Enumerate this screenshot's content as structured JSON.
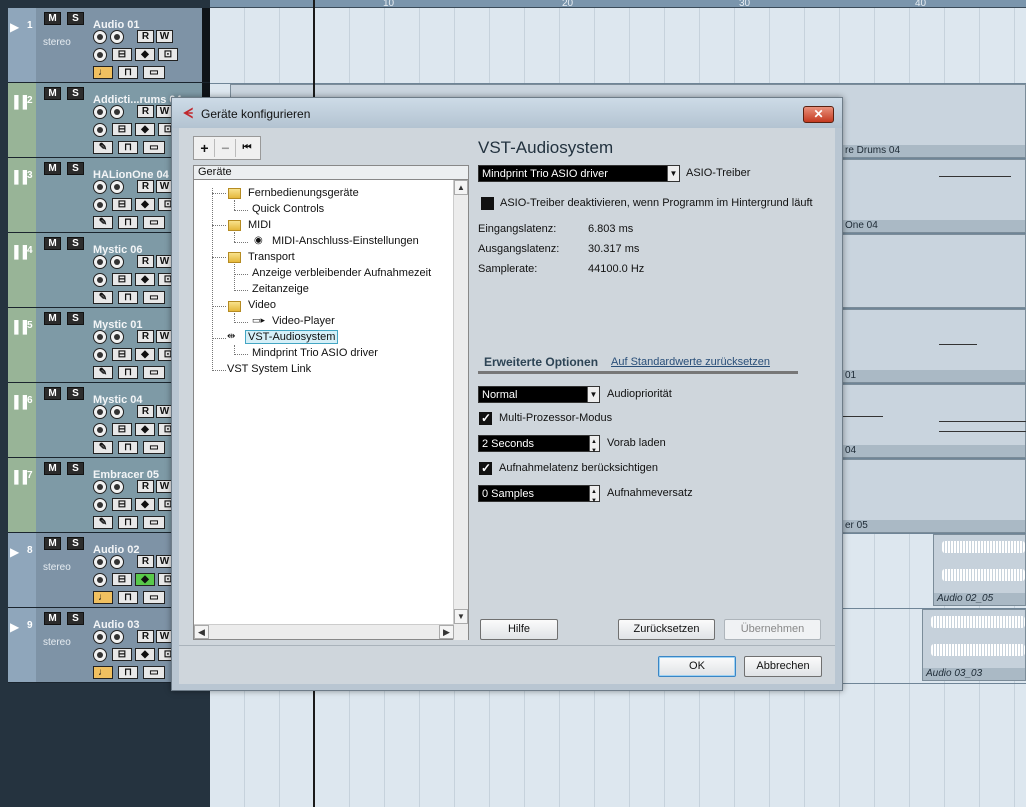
{
  "ruler": {
    "marks": [
      "10",
      "20",
      "30",
      "40"
    ]
  },
  "tracks": [
    {
      "num": "1",
      "name": "Audio 01",
      "sub": "stereo",
      "kind": "audio"
    },
    {
      "num": "2",
      "name": "Addicti...rums 04",
      "sub": "",
      "kind": "inst"
    },
    {
      "num": "3",
      "name": "HALionOne 04",
      "sub": "",
      "kind": "inst"
    },
    {
      "num": "4",
      "name": "Mystic 06",
      "sub": "",
      "kind": "inst"
    },
    {
      "num": "5",
      "name": "Mystic 01",
      "sub": "",
      "kind": "inst"
    },
    {
      "num": "6",
      "name": "Mystic 04",
      "sub": "",
      "kind": "inst"
    },
    {
      "num": "7",
      "name": "Embracer 05",
      "sub": "",
      "kind": "inst"
    },
    {
      "num": "8",
      "name": "Audio 02",
      "sub": "stereo",
      "kind": "audio"
    },
    {
      "num": "9",
      "name": "Audio 03",
      "sub": "stereo",
      "kind": "audio"
    }
  ],
  "track_buttons": {
    "mute": "M",
    "solo": "S",
    "read": "R",
    "write": "W",
    "edit": "e"
  },
  "parts": {
    "p2": "re Drums 04",
    "p3": "One 04",
    "p5": "01",
    "p6": "04",
    "p7": "er 05",
    "p8": "Audio 02_05",
    "p9": "Audio 03_03"
  },
  "dialog": {
    "title": "Geräte konfigurieren",
    "close": "✕",
    "toolbar": {
      "add": "+",
      "remove": "−",
      "reset": "⏮"
    },
    "tree_header": "Geräte",
    "tree": {
      "item1": "Fernbedienungsgeräte",
      "item1a": "Quick Controls",
      "item2": "MIDI",
      "item2a": "MIDI-Anschluss-Einstellungen",
      "item3": "Transport",
      "item3a": "Anzeige verbleibender Aufnahmezeit",
      "item3b": "Zeitanzeige",
      "item4": "Video",
      "item4a": "Video-Player",
      "item5": "VST-Audiosystem",
      "item5a": "Mindprint Trio ASIO driver",
      "item6": "VST System Link"
    },
    "panel": {
      "title": "VST-Audiosystem",
      "driver_value": "Mindprint Trio ASIO driver",
      "driver_label": "ASIO-Treiber",
      "deactivate_label": "ASIO-Treiber deaktivieren, wenn Programm im Hintergrund läuft",
      "input_latency_label": "Eingangslatenz:",
      "input_latency_value": "6.803 ms",
      "output_latency_label": "Ausgangslatenz:",
      "output_latency_value": "30.317 ms",
      "samplerate_label": "Samplerate:",
      "samplerate_value": "44100.0 Hz",
      "advanced_title": "Erweiterte Optionen",
      "reset_defaults": "Auf Standardwerte zurücksetzen",
      "priority_value": "Normal",
      "priority_label": "Audiopriorität",
      "multiproc_label": "Multi-Prozessor-Modus",
      "multiproc_checked": true,
      "preload_value": "2 Seconds",
      "preload_label": "Vorab laden",
      "latency_comp_label": "Aufnahmelatenz berücksichtigen",
      "latency_comp_checked": true,
      "offset_value": "0 Samples",
      "offset_label": "Aufnahmeversatz"
    },
    "buttons": {
      "help": "Hilfe",
      "reset": "Zurücksetzen",
      "apply": "Übernehmen",
      "ok": "OK",
      "cancel": "Abbrechen"
    }
  },
  "colors": {
    "audio_strip": "#8fa6bb",
    "inst_strip": "#98b497",
    "dialog_bg": "#b9c6d2",
    "close_red": "#c43a20",
    "selection": "#44a6c4"
  }
}
